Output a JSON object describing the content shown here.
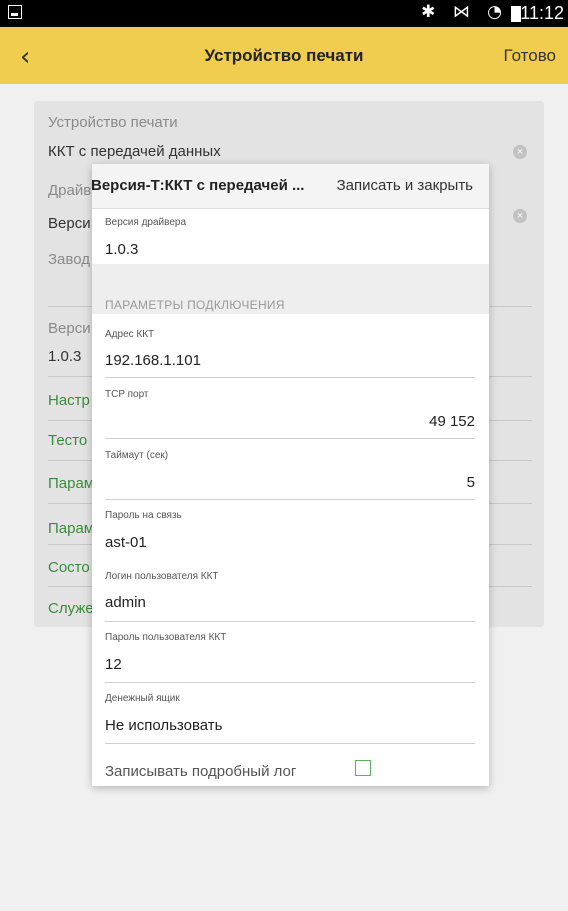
{
  "status_bar": {
    "icons": "✱ ⋈ ◔",
    "time": "11:12"
  },
  "appbar": {
    "back_icon": "‹",
    "title": "Устройство печати",
    "done_label": "Готово"
  },
  "background_form": {
    "device_label": "Устройство печати",
    "device_value": "ККТ с передачей данных",
    "driver_label": "Драйв",
    "driver_value": "Верси",
    "factory_label": "Завод",
    "version_label": "Верси",
    "version_value": "1.0.3",
    "links": [
      "Настр",
      "Тесто",
      "Парам",
      "Парам",
      "Состо",
      "Служе"
    ]
  },
  "modal": {
    "title": "Версия-Т:ККТ с передачей ...",
    "save_close_label": "Записать и закрыть",
    "driver_version_label": "Версия драйвера",
    "driver_version_value": "1.0.3",
    "section_title": "ПАРАМЕТРЫ ПОДКЛЮЧЕНИЯ",
    "fields": {
      "address_label": "Адрес ККТ",
      "address_value": "192.168.1.101",
      "tcp_label": "TCP порт",
      "tcp_value": "49 152",
      "timeout_label": "Таймаут (сек)",
      "timeout_value": "5",
      "password_label": "Пароль на связь",
      "password_value": "ast-01",
      "login_label": "Логин пользователя ККТ",
      "login_value": "admin",
      "user_password_label": "Пароль пользователя ККТ",
      "user_password_value": "12",
      "cash_drawer_label": "Денежный ящик",
      "cash_drawer_value": "Не использовать"
    },
    "log_checkbox_label": "Записывать подробный лог",
    "log_checkbox_checked": false
  }
}
